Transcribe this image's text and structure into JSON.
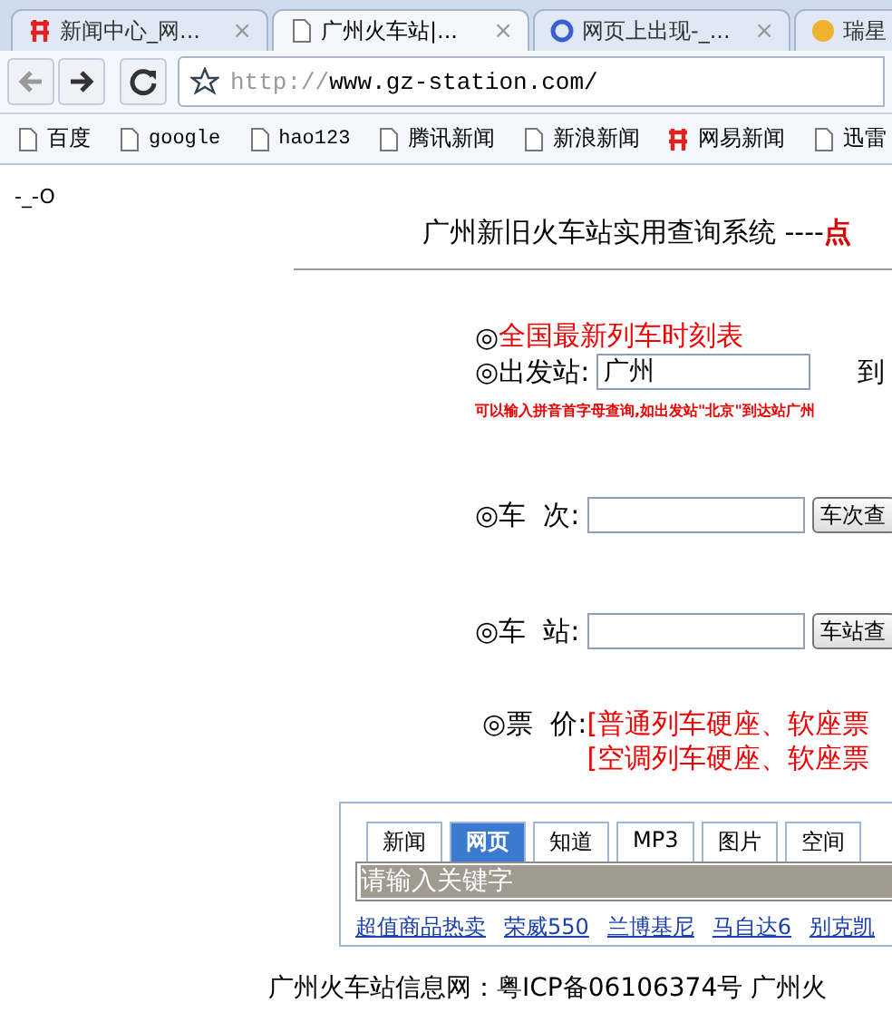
{
  "tabs": [
    {
      "label": "新闻中心_网...",
      "selected": false,
      "close": "×"
    },
    {
      "label": "广州火车站|...",
      "selected": true,
      "close": "×"
    },
    {
      "label": "网页上出现-_...",
      "selected": false,
      "close": "×"
    },
    {
      "label": "瑞星",
      "selected": false
    }
  ],
  "address": {
    "scheme": "http://",
    "rest": "www.gz-station.com/"
  },
  "bookmarks": [
    {
      "label": "百度"
    },
    {
      "label": "google"
    },
    {
      "label": "hao123"
    },
    {
      "label": "腾讯新闻"
    },
    {
      "label": "新浪新闻"
    },
    {
      "label": "网易新闻"
    },
    {
      "label": "迅雷"
    }
  ],
  "page": {
    "corner": "-_-O",
    "title": "广州新旧火车站实用查询系统 ----",
    "title_link": "点",
    "rows": [
      {
        "kind": "link",
        "marker": "◎",
        "text": "全国最新列车时刻表"
      },
      {
        "kind": "from",
        "marker": "◎",
        "label": "出发站:",
        "value": "广州",
        "to": "到",
        "hint": "可以输入拼音首字母查询,如出发站\"北京\"到达站广州"
      },
      {
        "kind": "query",
        "marker": "◎",
        "label": "车  次:",
        "button": "车次查"
      },
      {
        "kind": "query",
        "marker": "◎",
        "label": "车  站:",
        "button": "车站查"
      },
      {
        "kind": "price",
        "marker": "◎",
        "label": "票  价:",
        "lines": [
          "[普通列车硬座、软座票",
          "[空调列车硬座、软座票"
        ]
      }
    ],
    "search": {
      "tabs": [
        {
          "label": "新闻",
          "selected": false
        },
        {
          "label": "网页",
          "selected": true
        },
        {
          "label": "知道",
          "selected": false
        },
        {
          "label": "MP3",
          "selected": false
        },
        {
          "label": "图片",
          "selected": false
        },
        {
          "label": "空间",
          "selected": false
        }
      ],
      "placeholder": "请输入关键字",
      "links": [
        "超值商品热卖",
        "荣威550",
        "兰博基尼",
        "马自达6",
        "别克凯"
      ]
    },
    "footer": "广州火车站信息网：粤ICP备06106374号 广州火"
  }
}
